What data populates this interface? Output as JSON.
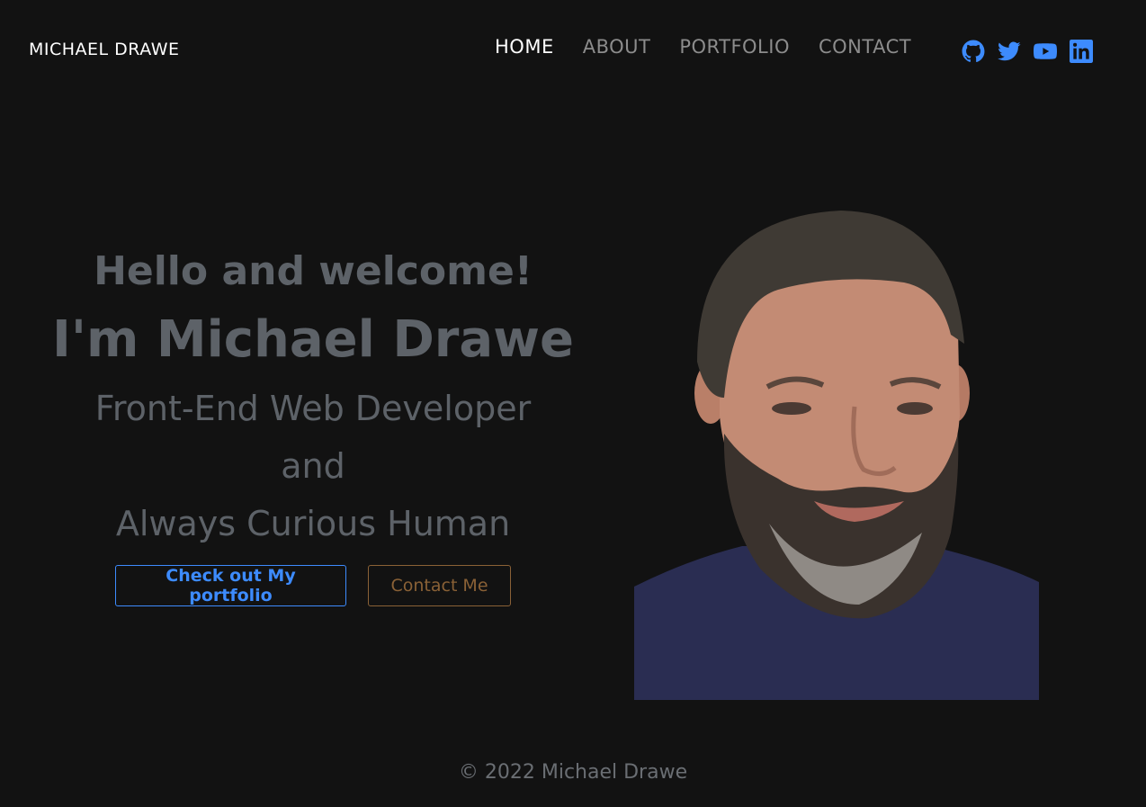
{
  "header": {
    "brand": "MICHAEL DRAWE",
    "nav": [
      {
        "label": "HOME",
        "active": true
      },
      {
        "label": "ABOUT",
        "active": false
      },
      {
        "label": "PORTFOLIO",
        "active": false
      },
      {
        "label": "CONTACT",
        "active": false
      }
    ],
    "socials": [
      {
        "icon": "github-icon"
      },
      {
        "icon": "twitter-icon"
      },
      {
        "icon": "youtube-icon"
      },
      {
        "icon": "linkedin-icon"
      }
    ],
    "accent_color": "#3d8bfd"
  },
  "hero": {
    "greeting": "Hello and welcome!",
    "name": "I'm Michael Drawe",
    "role": "Front-End Web Developer",
    "and": "and",
    "curious": "Always Curious Human",
    "portfolio_button": "Check out My portfolio",
    "contact_button": "Contact Me"
  },
  "footer": {
    "copyright": "© 2022 Michael Drawe"
  }
}
